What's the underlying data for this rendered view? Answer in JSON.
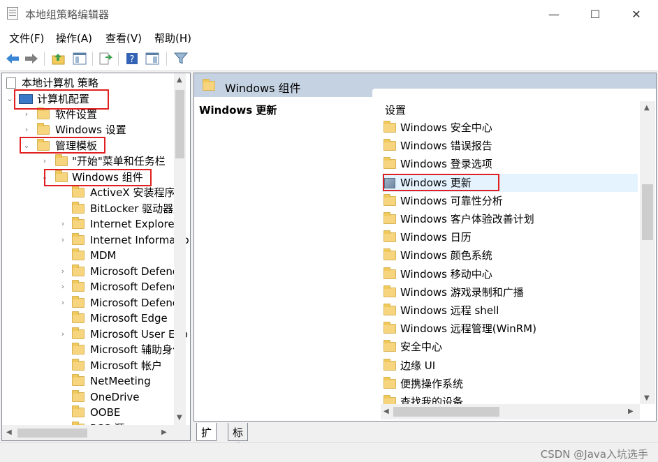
{
  "window": {
    "title": "本地组策略编辑器",
    "minimize": "—",
    "maximize": "☐",
    "close": "✕"
  },
  "menu": [
    "文件(F)",
    "操作(A)",
    "查看(V)",
    "帮助(H)"
  ],
  "toolbar": [
    "back-icon",
    "forward-icon",
    "up-folder-icon",
    "show-hide-tree-icon",
    "export-list-icon",
    "help-icon",
    "properties-icon",
    "filter-icon"
  ],
  "tree": {
    "root": "本地计算机 策略",
    "computer_config": "计算机配置",
    "software_settings": "软件设置",
    "windows_settings": "Windows 设置",
    "admin_templates": "管理模板",
    "start_menu": "\"开始\"菜单和任务栏",
    "windows_components": "Windows 组件",
    "children": [
      "ActiveX 安装程序服",
      "BitLocker 驱动器加",
      "Internet Explorer",
      "Internet Informatio",
      "MDM",
      "Microsoft Defende",
      "Microsoft Defende",
      "Microsoft Defende",
      "Microsoft Edge",
      "Microsoft User Exp",
      "Microsoft 辅助身份",
      "Microsoft 帐户",
      "NetMeeting",
      "OneDrive",
      "OOBE",
      "RSS 源"
    ]
  },
  "right": {
    "header": "Windows 组件",
    "left_title": "Windows 更新",
    "column": "设置",
    "items": [
      "Windows 安全中心",
      "Windows 错误报告",
      "Windows 登录选项",
      "Windows 更新",
      "Windows 可靠性分析",
      "Windows 客户体验改善计划",
      "Windows 日历",
      "Windows 颜色系统",
      "Windows 移动中心",
      "Windows 游戏录制和广播",
      "Windows 远程 shell",
      "Windows 远程管理(WinRM)",
      "安全中心",
      "边缘 UI",
      "便携操作系统",
      "查找我的设备"
    ],
    "selected_item": "Windows 更新"
  },
  "tabs": [
    "扩展",
    "标准"
  ],
  "watermark": "CSDN @Java入坑选手",
  "colors": {
    "highlight_box": "#e02020",
    "header_bg": "#c5d2e2",
    "selection": "#e5f3ff"
  }
}
